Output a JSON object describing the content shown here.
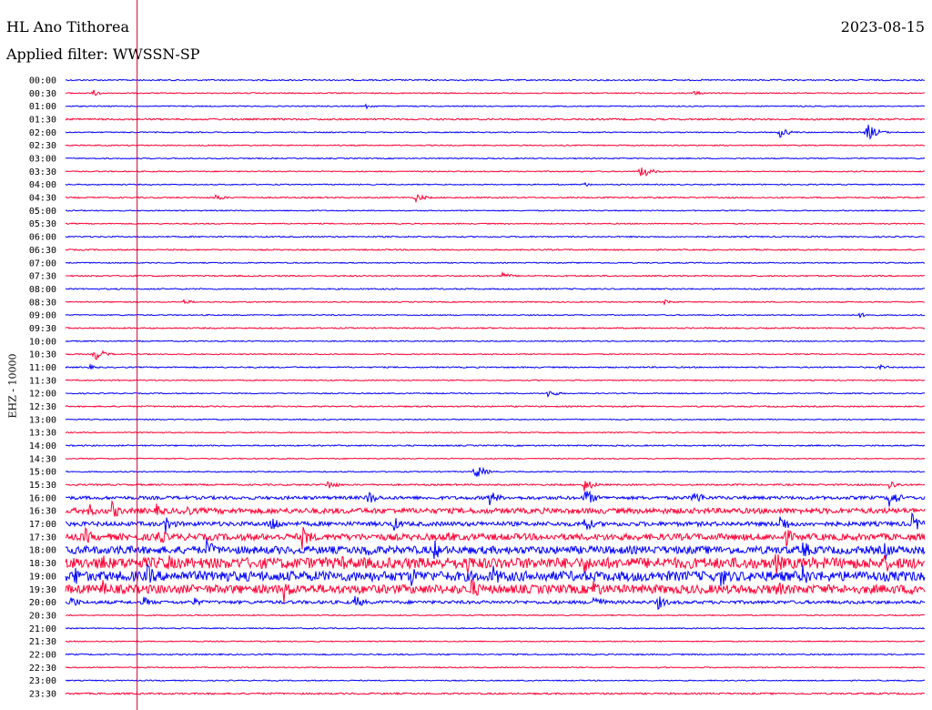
{
  "header": {
    "station": "HL Ano Tithorea",
    "date": "2023-08-15",
    "filter_label": "Applied filter: WWSSN-SP",
    "channel_label": "EHZ - 10000"
  },
  "colors": {
    "even_trace": "#0000ff",
    "odd_trace": "#ff0033",
    "marker": "#cc0033"
  },
  "chart_data": {
    "type": "helicorder",
    "rows": [
      {
        "label": "00:00",
        "level": 1.2,
        "events": []
      },
      {
        "label": "00:30",
        "level": 1,
        "events": [
          [
            30,
            4
          ],
          [
            690,
            3
          ]
        ]
      },
      {
        "label": "01:00",
        "level": 1,
        "events": [
          [
            330,
            3
          ]
        ]
      },
      {
        "label": "01:30",
        "level": 1.5,
        "events": []
      },
      {
        "label": "02:00",
        "level": 1,
        "events": [
          [
            785,
            6
          ],
          [
            880,
            11
          ]
        ]
      },
      {
        "label": "02:30",
        "level": 1,
        "events": []
      },
      {
        "label": "03:00",
        "level": 1,
        "events": []
      },
      {
        "label": "03:30",
        "level": 1,
        "events": [
          [
            632,
            8
          ]
        ]
      },
      {
        "label": "04:00",
        "level": 1,
        "events": [
          [
            568,
            3
          ]
        ]
      },
      {
        "label": "04:30",
        "level": 1.2,
        "events": [
          [
            165,
            4
          ],
          [
            385,
            5
          ]
        ]
      },
      {
        "label": "05:00",
        "level": 1,
        "events": []
      },
      {
        "label": "05:30",
        "level": 1,
        "events": []
      },
      {
        "label": "06:00",
        "level": 1.2,
        "events": []
      },
      {
        "label": "06:30",
        "level": 1.2,
        "events": []
      },
      {
        "label": "07:00",
        "level": 1,
        "events": []
      },
      {
        "label": "07:30",
        "level": 1.2,
        "events": [
          [
            480,
            4
          ]
        ]
      },
      {
        "label": "08:00",
        "level": 1.2,
        "events": []
      },
      {
        "label": "08:30",
        "level": 1,
        "events": [
          [
            130,
            3
          ],
          [
            658,
            3
          ]
        ]
      },
      {
        "label": "09:00",
        "level": 1,
        "events": [
          [
            872,
            3
          ]
        ]
      },
      {
        "label": "09:30",
        "level": 1.2,
        "events": []
      },
      {
        "label": "10:00",
        "level": 1,
        "events": []
      },
      {
        "label": "10:30",
        "level": 1,
        "events": [
          [
            32,
            8
          ]
        ]
      },
      {
        "label": "11:00",
        "level": 1.2,
        "events": [
          [
            25,
            3
          ],
          [
            895,
            3
          ]
        ]
      },
      {
        "label": "11:30",
        "level": 1,
        "events": []
      },
      {
        "label": "12:00",
        "level": 1,
        "events": [
          [
            530,
            5
          ]
        ]
      },
      {
        "label": "12:30",
        "level": 1.2,
        "events": []
      },
      {
        "label": "13:00",
        "level": 1,
        "events": []
      },
      {
        "label": "13:30",
        "level": 1,
        "events": []
      },
      {
        "label": "14:00",
        "level": 1.2,
        "events": []
      },
      {
        "label": "14:30",
        "level": 1,
        "events": []
      },
      {
        "label": "15:00",
        "level": 1,
        "events": [
          [
            450,
            9
          ]
        ]
      },
      {
        "label": "15:30",
        "level": 1.5,
        "events": [
          [
            288,
            6
          ],
          [
            570,
            8
          ],
          [
            905,
            6
          ]
        ]
      },
      {
        "label": "16:00",
        "level": 3,
        "events": [
          [
            332,
            9
          ],
          [
            465,
            10
          ],
          [
            570,
            12
          ],
          [
            690,
            10
          ],
          [
            905,
            12
          ]
        ]
      },
      {
        "label": "16:30",
        "level": 5,
        "events": [
          [
            25,
            9
          ],
          [
            50,
            12
          ],
          [
            100,
            8
          ],
          [
            130,
            9
          ]
        ]
      },
      {
        "label": "17:00",
        "level": 4,
        "events": [
          [
            110,
            10
          ],
          [
            225,
            12
          ],
          [
            360,
            9
          ],
          [
            570,
            10
          ],
          [
            785,
            12
          ],
          [
            930,
            12
          ]
        ]
      },
      {
        "label": "17:30",
        "level": 6,
        "events": [
          [
            20,
            12
          ],
          [
            100,
            13
          ],
          [
            260,
            14
          ],
          [
            420,
            9
          ],
          [
            790,
            12
          ]
        ]
      },
      {
        "label": "18:00",
        "level": 7,
        "events": [
          [
            60,
            9
          ],
          [
            155,
            13
          ],
          [
            330,
            13
          ],
          [
            405,
            12
          ],
          [
            600,
            9
          ],
          [
            810,
            12
          ],
          [
            900,
            12
          ]
        ]
      },
      {
        "label": "18:30",
        "level": 10,
        "events": [
          [
            40,
            13
          ],
          [
            110,
            13
          ],
          [
            300,
            13
          ],
          [
            440,
            14
          ],
          [
            570,
            12
          ],
          [
            780,
            14
          ],
          [
            900,
            12
          ]
        ]
      },
      {
        "label": "19:00",
        "level": 9,
        "events": [
          [
            10,
            13
          ],
          [
            90,
            14
          ],
          [
            170,
            13
          ],
          [
            380,
            12
          ],
          [
            470,
            13
          ],
          [
            720,
            13
          ],
          [
            810,
            14
          ]
        ]
      },
      {
        "label": "19:30",
        "level": 8,
        "events": [
          [
            40,
            12
          ],
          [
            240,
            15
          ],
          [
            445,
            15
          ],
          [
            580,
            13
          ],
          [
            780,
            13
          ],
          [
            930,
            12
          ]
        ]
      },
      {
        "label": "20:00",
        "level": 3,
        "events": [
          [
            5,
            8
          ],
          [
            85,
            7
          ],
          [
            140,
            6
          ],
          [
            318,
            8
          ],
          [
            580,
            10
          ],
          [
            650,
            9
          ]
        ]
      },
      {
        "label": "20:30",
        "level": 1,
        "events": []
      },
      {
        "label": "21:00",
        "level": 1,
        "events": []
      },
      {
        "label": "21:30",
        "level": 1,
        "events": []
      },
      {
        "label": "22:00",
        "level": 1.2,
        "events": []
      },
      {
        "label": "22:30",
        "level": 1,
        "events": []
      },
      {
        "label": "23:00",
        "level": 1,
        "events": []
      },
      {
        "label": "23:30",
        "level": 1.5,
        "events": []
      }
    ],
    "marker_time_min": 2.5
  }
}
